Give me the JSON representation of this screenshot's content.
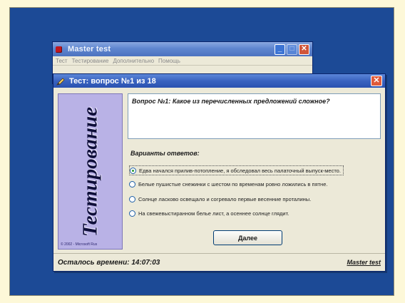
{
  "main_window": {
    "title": "Master test",
    "menu": [
      "Тест",
      "Тестирование",
      "Дополнительно",
      "Помощь"
    ]
  },
  "dialog": {
    "title": "Тест: вопрос №1 из 18",
    "banner_text": "Тестирование",
    "banner_copyright": "© 2002 - Microsoft Rus",
    "question": "Вопрос №1: Какое из перечисленных предложений сложное?",
    "answers_label": "Варианты ответов:",
    "answers": [
      {
        "text": "Едва начался прилив-потопление, я обследовал весь палаточный выпуск-место.",
        "selected": true
      },
      {
        "text": "Белые пушистые снежинки с шестом по временам ровно ложились в пятне.",
        "selected": false
      },
      {
        "text": "Солнце ласково освещало и согревало первые весенние проталины.",
        "selected": false
      },
      {
        "text": "На свежевыстиранном белье лист, а осеннее солнце глядит.",
        "selected": false
      }
    ],
    "next_label": "Далее",
    "time_left": "Осталось времени: 14:07:03",
    "brand": "Master test"
  },
  "colors": {
    "desktop": "#1c4a96",
    "banner": "#b9b2e6",
    "titlebar": "#3a63c0"
  }
}
